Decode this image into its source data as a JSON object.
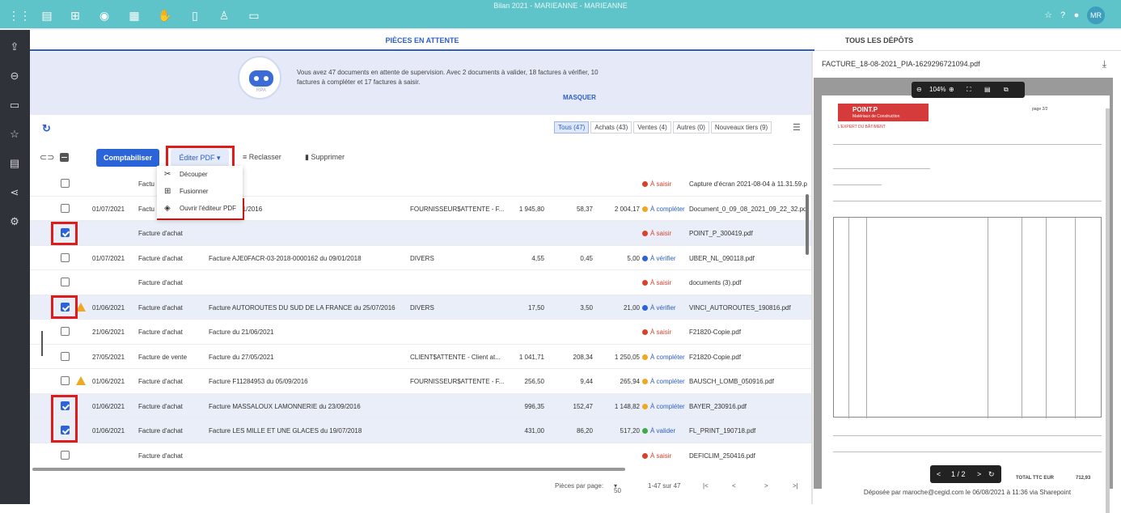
{
  "app": {
    "title": "Bilan 2021 - MARIEANNE - MARIEANNE",
    "user_initials": "MR",
    "accent": "#5ec4c9",
    "primary": "#2b63d9"
  },
  "topbar_icons": [
    "apps-grid-icon",
    "document-icon",
    "org-chart-icon",
    "coins-icon",
    "calculator-icon",
    "hand-money-icon",
    "book-icon",
    "person-stack-icon",
    "file-edit-icon"
  ],
  "topbar_right_icons": [
    "star-icon",
    "help-icon",
    "notification-icon"
  ],
  "sidebar_icons": [
    "share-icon",
    "inbox-icon",
    "layers-icon",
    "star-icon",
    "document-chart-icon",
    "share-nodes-icon",
    "settings-icon"
  ],
  "tabs": {
    "active": "PIÈCES EN ATTENTE",
    "other": "TOUS LES DÉPÔTS"
  },
  "banner": {
    "text": "Vous avez 47 documents en attente de supervision. Avec 2 documents à valider, 18 factures à vérifier, 10 factures à compléter et 17 factures à saisir.",
    "hide_label": "MASQUER",
    "robot_mark": "RPA"
  },
  "filters": [
    "Tous (47)",
    "Achats (43)",
    "Ventes (4)",
    "Autres (0)",
    "Nouveaux tiers (9)"
  ],
  "toolbar": {
    "comptabiliser": "Comptabiliser",
    "editer_pdf": "Éditer PDF",
    "reclasser": "Reclasser",
    "supprimer": "Supprimer"
  },
  "menu": {
    "decouper": "Découper",
    "fusionner": "Fusionner",
    "ouvrir": "Ouvrir l'éditeur PDF"
  },
  "rows": [
    {
      "date": "",
      "type": "Factu",
      "lib": "",
      "tiers": "",
      "ht": "",
      "tva": "",
      "ttc": "",
      "status": "À saisir",
      "file": "Capture d'écran 2021-08-04 à 11.31.59.p"
    },
    {
      "date": "01/07/2021",
      "type": "Factu",
      "lib": "147 du 17/11/2016",
      "tiers": "FOURNISSEUR$ATTENTE - F...",
      "ht": "1 945,80",
      "tva": "58,37",
      "ttc": "2 004,17",
      "status": "À compléter",
      "file": "Document_0_09_08_2021_09_22_32.pd"
    },
    {
      "date": "",
      "type": "Facture d'achat",
      "lib": "",
      "tiers": "",
      "ht": "",
      "tva": "",
      "ttc": "",
      "status": "À saisir",
      "file": "POINT_P_300419.pdf"
    },
    {
      "date": "01/07/2021",
      "type": "Facture d'achat",
      "lib": "Facture AJE0FACR-03-2018-0000162 du 09/01/2018",
      "tiers": "DIVERS",
      "ht": "4,55",
      "tva": "0,45",
      "ttc": "5,00",
      "status": "À vérifier",
      "file": "UBER_NL_090118.pdf"
    },
    {
      "date": "",
      "type": "Facture d'achat",
      "lib": "",
      "tiers": "",
      "ht": "",
      "tva": "",
      "ttc": "",
      "status": "À saisir",
      "file": "documents (3).pdf"
    },
    {
      "date": "01/06/2021",
      "type": "Facture d'achat",
      "lib": "Facture AUTOROUTES DU SUD DE LA FRANCE du 25/07/2016",
      "tiers": "DIVERS",
      "ht": "17,50",
      "tva": "3,50",
      "ttc": "21,00",
      "status": "À vérifier",
      "file": "VINCI_AUTOROUTES_190816.pdf"
    },
    {
      "date": "21/06/2021",
      "type": "Facture d'achat",
      "lib": "Facture du 21/06/2021",
      "tiers": "",
      "ht": "",
      "tva": "",
      "ttc": "",
      "status": "À saisir",
      "file": "F21820-Copie.pdf"
    },
    {
      "date": "27/05/2021",
      "type": "Facture de vente",
      "lib": "Facture du 27/05/2021",
      "tiers": "CLIENT$ATTENTE - Client at...",
      "ht": "1 041,71",
      "tva": "208,34",
      "ttc": "1 250,05",
      "status": "À compléter",
      "file": "F21820-Copie.pdf"
    },
    {
      "date": "01/06/2021",
      "type": "Facture d'achat",
      "lib": "Facture F11284953 du 05/09/2016",
      "tiers": "FOURNISSEUR$ATTENTE - F...",
      "ht": "256,50",
      "tva": "9,44",
      "ttc": "265,94",
      "status": "À compléter",
      "file": "BAUSCH_LOMB_050916.pdf"
    },
    {
      "date": "01/06/2021",
      "type": "Facture d'achat",
      "lib": "Facture MASSALOUX LAMONNERIE du 23/09/2016",
      "tiers": "",
      "ht": "996,35",
      "tva": "152,47",
      "ttc": "1 148,82",
      "status": "À compléter",
      "file": "BAYER_230916.pdf"
    },
    {
      "date": "01/06/2021",
      "type": "Facture d'achat",
      "lib": "Facture LES MILLE ET UNE GLACES du 19/07/2018",
      "tiers": "",
      "ht": "431,00",
      "tva": "86,20",
      "ttc": "517,20",
      "status": "À valider",
      "file": "FL_PRINT_190718.pdf"
    },
    {
      "date": "",
      "type": "Facture d'achat",
      "lib": "",
      "tiers": "",
      "ht": "",
      "tva": "",
      "ttc": "",
      "status": "À saisir",
      "file": "DEFICLIM_250416.pdf"
    }
  ],
  "status_colors": {
    "À saisir": "#d9412b",
    "À compléter": "#f0a820",
    "À vérifier": "#2b63d9",
    "À valider": "#3cab4a"
  },
  "pager": {
    "label": "Pièces par page:",
    "per_page": "50",
    "range": "1-47 sur 47"
  },
  "preview": {
    "filename": "FACTURE_18-08-2021_PIA-1629296721094.pdf",
    "zoom": "104%",
    "page": "1 / 2",
    "footer": "Déposée par maroche@cegid.com le 06/08/2021 à 11:36 via Sharepoint",
    "page_number": "page 2/2",
    "logo_title": "POINT.P",
    "logo_sub": "Matériaux de Construction",
    "logo_tagline": "L'EXPERT DU BÂTIMENT",
    "total_label": "TOTAL TTC EUR",
    "total_value": "712,93"
  }
}
